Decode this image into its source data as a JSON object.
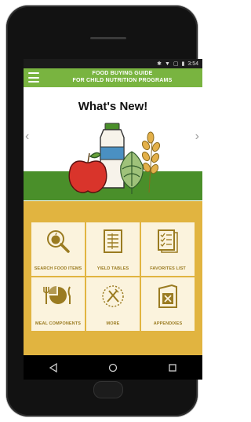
{
  "status_bar": {
    "icons": [
      "bluetooth-icon",
      "wifi-icon",
      "no-sim-icon",
      "battery-icon"
    ],
    "time": "3:54"
  },
  "app_bar": {
    "title_line1": "FOOD BUYING GUIDE",
    "title_line2": "FOR CHILD NUTRITION PROGRAMS",
    "color": "#79b440"
  },
  "banner": {
    "heading": "What's New!",
    "prev_glyph": "‹",
    "next_glyph": "›",
    "band_color": "#4a8f2a"
  },
  "menu_tiles": [
    {
      "label": "SEARCH FOOD ITEMS",
      "icon": "magnifier-apple-icon"
    },
    {
      "label": "YIELD TABLES",
      "icon": "document-table-icon"
    },
    {
      "label": "FAVORITES LIST",
      "icon": "checklist-icon"
    },
    {
      "label": "MEAL COMPONENTS",
      "icon": "meal-pie-icon"
    },
    {
      "label": "MORE",
      "icon": "fork-knife-clock-icon"
    },
    {
      "label": "APPENDIXES",
      "icon": "folder-x-icon"
    }
  ],
  "nav": {
    "buttons": [
      "back-icon",
      "home-icon",
      "recents-icon"
    ]
  },
  "colors": {
    "grid_background": "#e1b440",
    "tile_background": "#fbf3dd",
    "tile_text": "#9a7b21"
  }
}
